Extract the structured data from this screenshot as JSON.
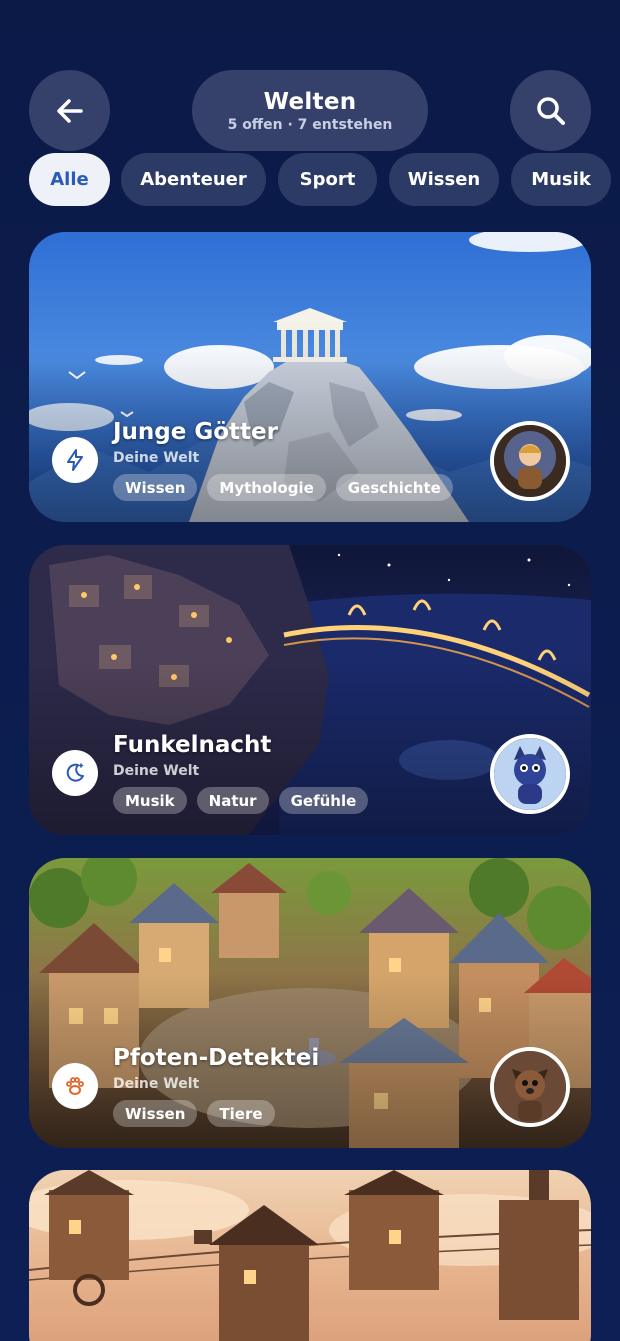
{
  "header": {
    "title": "Welten",
    "subtitle": "5 offen · 7 entstehen",
    "back_icon": "arrow-left-icon",
    "search_icon": "search-icon"
  },
  "filters": [
    {
      "label": "Alle",
      "active": true
    },
    {
      "label": "Abenteuer",
      "active": false
    },
    {
      "label": "Sport",
      "active": false
    },
    {
      "label": "Wissen",
      "active": false
    },
    {
      "label": "Musik",
      "active": false
    }
  ],
  "worlds": [
    {
      "title": "Junge Götter",
      "subtitle": "Deine Welt",
      "icon": "lightning-icon",
      "tags": [
        "Wissen",
        "Mythologie",
        "Geschichte"
      ]
    },
    {
      "title": "Funkelnacht",
      "subtitle": "Deine Welt",
      "icon": "moon-stars-icon",
      "tags": [
        "Musik",
        "Natur",
        "Gefühle"
      ]
    },
    {
      "title": "Pfoten-Detektei",
      "subtitle": "Deine Welt",
      "icon": "paw-icon",
      "tags": [
        "Wissen",
        "Tiere"
      ]
    }
  ],
  "colors": {
    "background": "#0b1a47",
    "pill": "#35416a",
    "chip": "#2c3a66",
    "chip_active_bg": "#eef1f8",
    "chip_active_text": "#2a59b8"
  }
}
